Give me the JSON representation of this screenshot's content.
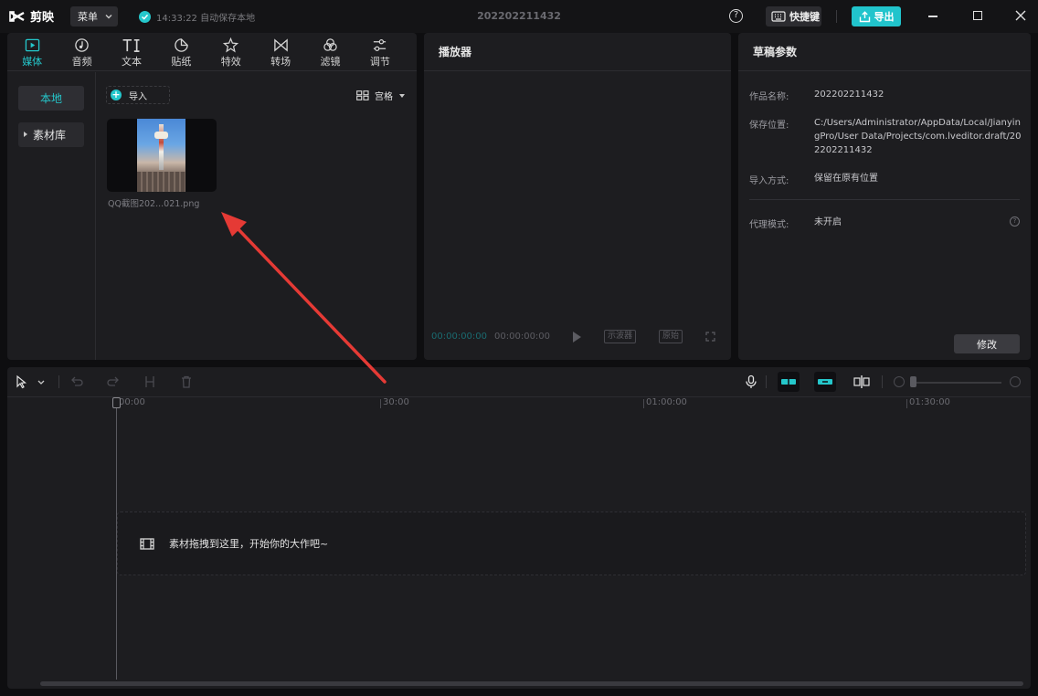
{
  "titlebar": {
    "app_name": "剪映",
    "menu_label": "菜单",
    "autosave_text": "14:33:22 自动保存本地",
    "doc_title": "202202211432",
    "shortcut_label": "快捷键",
    "export_label": "导出"
  },
  "media": {
    "tabs": [
      {
        "label": "媒体",
        "icon": "media-icon",
        "active": true
      },
      {
        "label": "音频",
        "icon": "audio-icon"
      },
      {
        "label": "文本",
        "icon": "text-icon"
      },
      {
        "label": "贴纸",
        "icon": "sticker-icon"
      },
      {
        "label": "特效",
        "icon": "effects-icon"
      },
      {
        "label": "转场",
        "icon": "transition-icon"
      },
      {
        "label": "滤镜",
        "icon": "filter-icon"
      },
      {
        "label": "调节",
        "icon": "adjust-icon"
      }
    ],
    "side_nav": {
      "local": "本地",
      "library": "素材库"
    },
    "import_label": "导入",
    "view_label": "宫格",
    "file_name": "QQ截图202...021.png"
  },
  "player": {
    "title": "播放器",
    "current_time": "00:00:00:00",
    "total_time": "00:00:00:00",
    "scope_label": "示波器",
    "ratio_label": "原始"
  },
  "props": {
    "title": "草稿参数",
    "rows": [
      {
        "label": "作品名称:",
        "value": "202202211432"
      },
      {
        "label": "保存位置:",
        "value": "C:/Users/Administrator/AppData/Local/JianyingPro/User Data/Projects/com.lveditor.draft/202202211432"
      },
      {
        "label": "导入方式:",
        "value": "保留在原有位置"
      },
      {
        "label": "代理模式:",
        "value": "未开启"
      }
    ],
    "modify_label": "修改"
  },
  "timeline": {
    "ruler": [
      "00:00",
      "30:00",
      "01:00:00",
      "01:30:00"
    ],
    "drop_hint": "素材拖拽到这里，开始你的大作吧~"
  },
  "colors": {
    "accent": "#25c7cb",
    "annotation_arrow": "#e53a35"
  }
}
